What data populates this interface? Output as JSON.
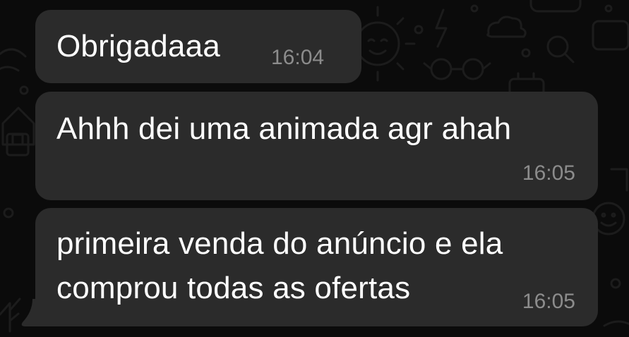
{
  "chat": {
    "messages": [
      {
        "text": "Obrigadaaa",
        "time": "16:04"
      },
      {
        "text": "Ahhh dei uma animada agr ahah",
        "time": "16:05"
      },
      {
        "lines": [
          "primeira venda do anúncio e ela",
          "comprou todas as ofertas"
        ],
        "time": "16:05"
      }
    ]
  },
  "colors": {
    "background": "#0b0b0b",
    "bubble": "#2b2b2b",
    "text": "#ffffff",
    "timestamp": "#8c8c8c"
  }
}
